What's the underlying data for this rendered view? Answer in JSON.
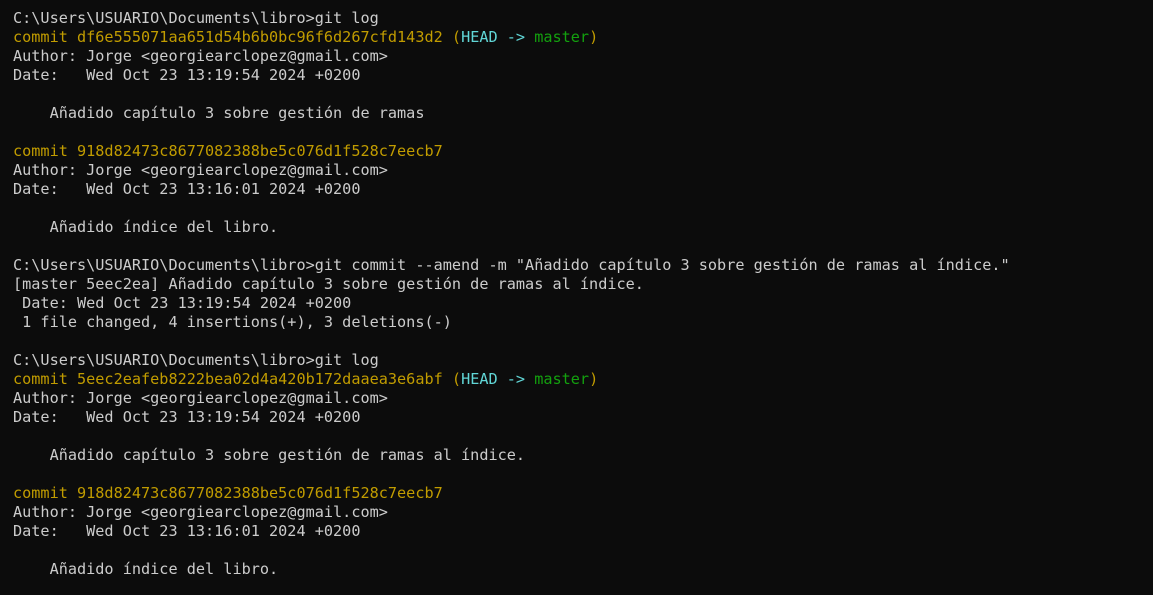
{
  "colors": {
    "background": "#0c0c0c",
    "text": "#cccccc",
    "commit": "#c19c00",
    "head": "#61d6d6",
    "branch": "#13a10e"
  },
  "log1": {
    "prompt": "C:\\Users\\USUARIO\\Documents\\libro>git log",
    "commit1": {
      "hash_line": "commit df6e555071aa651d54b6b0bc96f6d267cfd143d2",
      "open_paren": " (",
      "head": "HEAD",
      "arrow": " -> ",
      "branch": "master",
      "close_paren": ")",
      "author": "Author: Jorge <georgiearclopez@gmail.com>",
      "date": "Date:   Wed Oct 23 13:19:54 2024 +0200",
      "message": "    Añadido capítulo 3 sobre gestión de ramas"
    },
    "commit2": {
      "hash_line": "commit 918d82473c8677082388be5c076d1f528c7eecb7",
      "author": "Author: Jorge <georgiearclopez@gmail.com>",
      "date": "Date:   Wed Oct 23 13:16:01 2024 +0200",
      "message": "    Añadido índice del libro."
    }
  },
  "amend": {
    "prompt": "C:\\Users\\USUARIO\\Documents\\libro>git commit --amend -m \"Añadido capítulo 3 sobre gestión de ramas al índice.\"",
    "result": "[master 5eec2ea] Añadido capítulo 3 sobre gestión de ramas al índice.",
    "date": " Date: Wed Oct 23 13:19:54 2024 +0200",
    "stats": " 1 file changed, 4 insertions(+), 3 deletions(-)"
  },
  "log2": {
    "prompt": "C:\\Users\\USUARIO\\Documents\\libro>git log",
    "commit1": {
      "hash_line": "commit 5eec2eafeb8222bea02d4a420b172daaea3e6abf",
      "open_paren": " (",
      "head": "HEAD",
      "arrow": " -> ",
      "branch": "master",
      "close_paren": ")",
      "author": "Author: Jorge <georgiearclopez@gmail.com>",
      "date": "Date:   Wed Oct 23 13:19:54 2024 +0200",
      "message": "    Añadido capítulo 3 sobre gestión de ramas al índice."
    },
    "commit2": {
      "hash_line": "commit 918d82473c8677082388be5c076d1f528c7eecb7",
      "author": "Author: Jorge <georgiearclopez@gmail.com>",
      "date": "Date:   Wed Oct 23 13:16:01 2024 +0200",
      "message": "    Añadido índice del libro."
    }
  }
}
